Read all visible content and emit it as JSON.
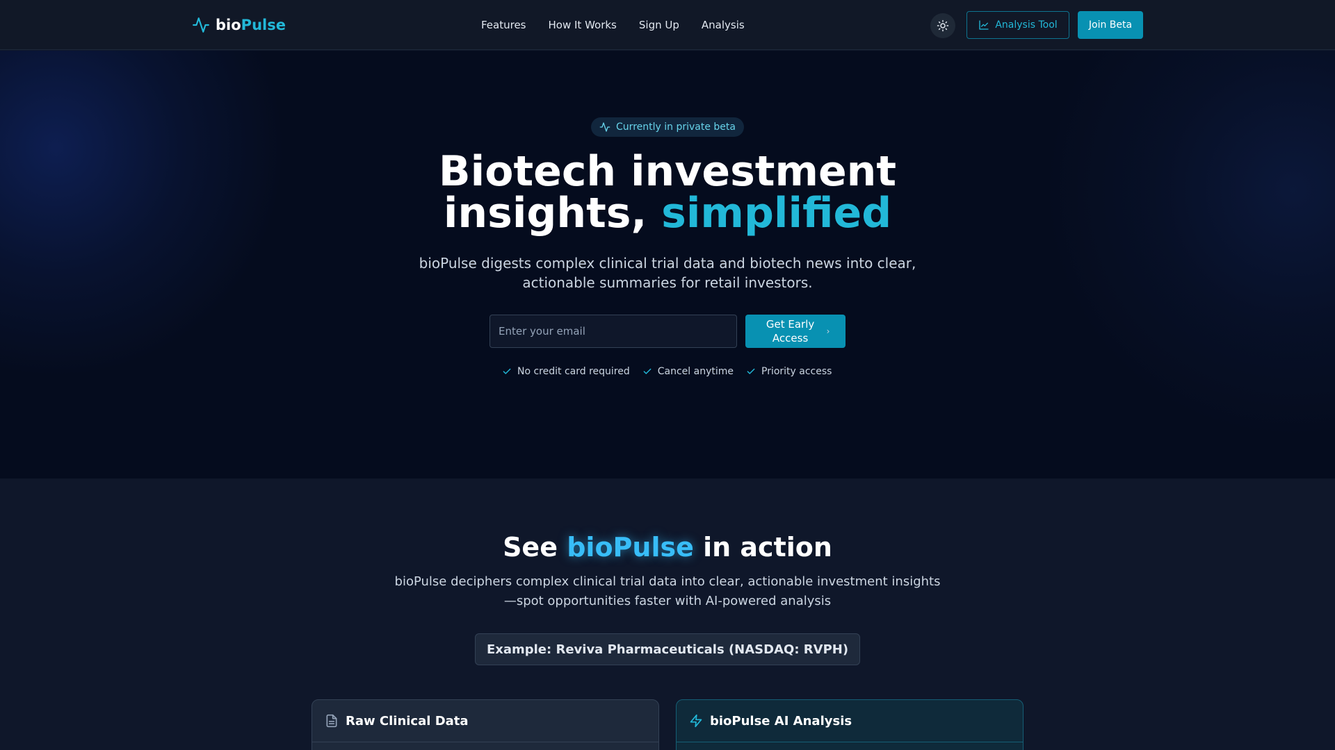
{
  "nav": {
    "logo_prefix": "bio",
    "logo_suffix": "Pulse",
    "logo_icon": "pulse-icon",
    "links": [
      {
        "label": "Features"
      },
      {
        "label": "How It Works"
      },
      {
        "label": "Sign Up"
      },
      {
        "label": "Analysis"
      }
    ],
    "theme_icon": "sun-icon",
    "analysis_tool_label": "Analysis Tool",
    "analysis_tool_icon": "line-chart-icon",
    "join_beta_label": "Join Beta"
  },
  "hero": {
    "badge": "Currently in private beta",
    "badge_icon": "pulse-icon",
    "title_line1": "Biotech investment",
    "title_line2_plain": "insights, ",
    "title_line2_accent": "simplified",
    "subtitle": "bioPulse digests complex clinical trial data and biotech news into clear, actionable summaries for retail investors.",
    "email_placeholder": "Enter your email",
    "email_value": "",
    "cta_label": "Get Early Access",
    "checks": [
      {
        "label": "No credit card required"
      },
      {
        "label": "Cancel anytime"
      },
      {
        "label": "Priority access"
      }
    ]
  },
  "demo": {
    "title_prefix": "See ",
    "title_accent": "bioPulse",
    "title_suffix": " in action",
    "subtitle": "bioPulse deciphers complex clinical trial data into clear, actionable investment insights—spot opportunities faster with AI-powered analysis",
    "example": "Example: Reviva Pharmaceuticals (NASDAQ: RVPH)",
    "card_raw_title": "Raw Clinical Data",
    "card_raw_icon": "document-icon",
    "card_ai_title": "bioPulse AI Analysis",
    "card_ai_icon": "lightning-icon"
  },
  "colors": {
    "accent": "#22b8d8",
    "primary_button": "#0891b2",
    "nav_bg": "#111827",
    "hero_bg": "#050c1e",
    "page_bg": "#0f172a"
  }
}
